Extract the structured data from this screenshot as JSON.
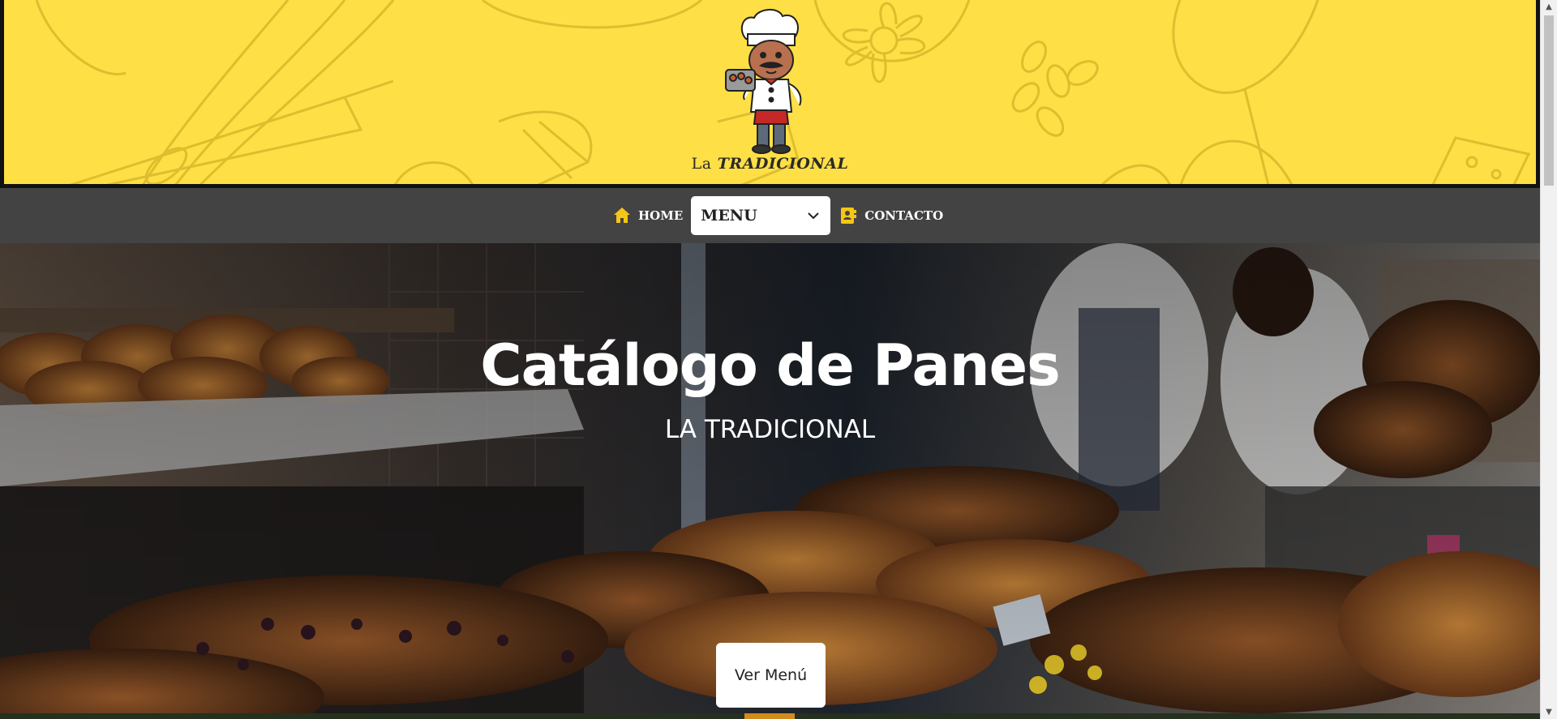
{
  "header": {
    "logo_prefix": "La",
    "logo_name": "TRADICIONAL",
    "bg_color": "#fedf45"
  },
  "nav": {
    "home_label": "HOME",
    "menu_label": "MENU",
    "contact_label": "CONTACTO",
    "accent": "#f5c518"
  },
  "hero": {
    "title": "Catálogo de Panes",
    "subtitle": "LA TRADICIONAL",
    "button_label": "Ver Menú"
  },
  "scrollbar": {
    "up_glyph": "▲",
    "down_glyph": "▼"
  }
}
